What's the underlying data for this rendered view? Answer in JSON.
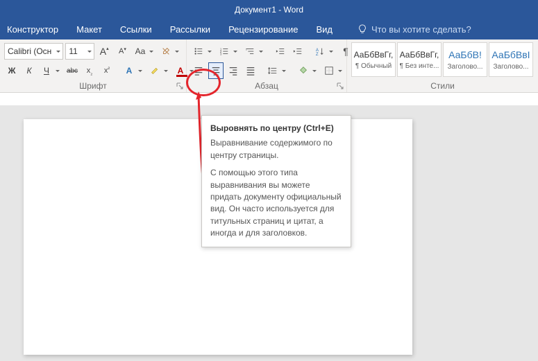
{
  "title": "Документ1  -  Word",
  "tabs": [
    "Конструктор",
    "Макет",
    "Ссылки",
    "Рассылки",
    "Рецензирование",
    "Вид"
  ],
  "tellme": "Что вы хотите сделать?",
  "font": {
    "name": "Calibri (Осн",
    "size": "11"
  },
  "group_labels": {
    "font": "Шрифт",
    "para": "Абзац",
    "styles": "Стили"
  },
  "font_btn": {
    "growA": "A",
    "shrinkA": "A",
    "aa": "Aa",
    "bold": "Ж",
    "italic": "К",
    "under": "Ч",
    "strike": "abc",
    "sub": "x",
    "sup": "x",
    "A1": "A",
    "A2": "A"
  },
  "tooltip": {
    "title": "Выровнять по центру (Ctrl+E)",
    "p1": "Выравнивание содержимого по центру страницы.",
    "p2": "С помощью этого типа выравнивания вы можете придать документу официальный вид. Он часто используется для титульных страниц и цитат, а иногда и для заголовков."
  },
  "styles": [
    {
      "preview": "АаБбВвГг,",
      "name": "¶ Обычный",
      "blue": false
    },
    {
      "preview": "АаБбВвГг,",
      "name": "¶ Без инте...",
      "blue": false
    },
    {
      "preview": "АаБбВ!",
      "name": "Заголово...",
      "blue": true
    },
    {
      "preview": "АаБбВвІ",
      "name": "Заголово...",
      "blue": true
    }
  ]
}
